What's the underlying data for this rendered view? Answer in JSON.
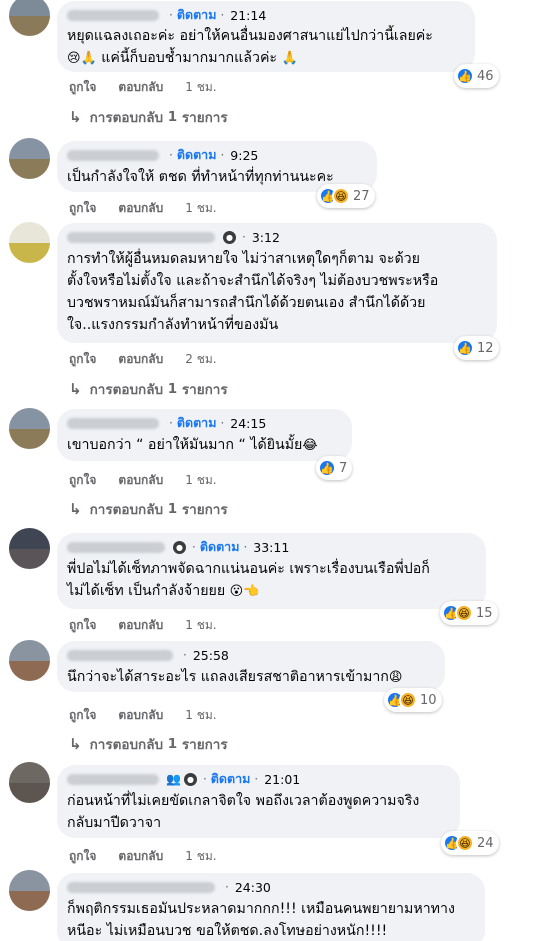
{
  "labels": {
    "follow": "ติดตาม",
    "like": "ถูกใจ",
    "reply": "ตอบกลับ",
    "replies_prefix": "การตอบกลับ",
    "replies_suffix": "รายการ"
  },
  "comments": [
    {
      "time": "21:14",
      "following": true,
      "lines": [
        "หยุดแฉลงเถอะค่ะ อย่าให้คนอื่นมองศาสนาแย่ไปกว่านี้เลยค่ะ",
        "แค่นี้ก็บอบช้ำมากมากแล้วค่ะ"
      ],
      "age": "1 ชม.",
      "reactions": [
        "like"
      ],
      "reaction_count": "46",
      "reply_count": "1"
    },
    {
      "time": "9:25",
      "following": true,
      "lines": [
        "เป็นกำลังใจให้ ตชด ที่ทำหน้าที่ทุกท่านนะคะ"
      ],
      "age": "1 ชม.",
      "reactions": [
        "like",
        "haha"
      ],
      "reaction_count": "27",
      "reply_count": null
    },
    {
      "time": "3:12",
      "following": false,
      "lines": [
        "การทำให้ผู้อื่นหมดลมหายใจ ไม่ว่าสาเหตุใดๆก็ตาม จะด้วย",
        "ตั้งใจหรือไม่ตั้งใจ และถ้าจะสำนึกได้จริงๆ ไม่ต้องบวชพระหรือ",
        "บวชพราหมณ์มันก็สามารถสำนึกได้ด้วยตนเอง สำนึกได้ด้วย",
        "ใจ..แรงกรรมกำลังทำหน้าที่ของมัน"
      ],
      "age": "2 ชม.",
      "reactions": [
        "like"
      ],
      "reaction_count": "12",
      "reply_count": "1"
    },
    {
      "time": "24:15",
      "following": true,
      "lines": [
        "เขาบอกว่า “ อย่าให้มันมาก “ ได้ยินมั้ย"
      ],
      "age": "1 ชม.",
      "reactions": [
        "like"
      ],
      "reaction_count": "7",
      "reply_count": "1"
    },
    {
      "time": "33:11",
      "following": true,
      "lines": [
        "พี่ปอไม่ได้เซ็ทภาพจัดฉากแน่นอนค่ะ เพราะเรื่องบนเรือพี่ปอก็",
        "ไม่ได้เซ็ท เป็นกำลังจ้ายยย"
      ],
      "age": "1 ชม.",
      "reactions": [
        "like",
        "haha"
      ],
      "reaction_count": "15",
      "reply_count": null
    },
    {
      "time": "25:58",
      "following": false,
      "lines": [
        "นึกว่าจะได้สาระอะไร แถลงเสียรสชาติอาหารเข้ามาก"
      ],
      "age": "1 ชม.",
      "reactions": [
        "like",
        "haha"
      ],
      "reaction_count": "10",
      "reply_count": "1"
    },
    {
      "time": "21:01",
      "following": true,
      "lines": [
        "ก่อนหน้าที่ไม่เคยขัดเกลาจิตใจ พอถึงเวลาต้องพูดความจริง",
        "กลับมาปีดวาจา"
      ],
      "age": "1 ชม.",
      "reactions": [
        "like",
        "haha"
      ],
      "reaction_count": "24",
      "reply_count": null
    },
    {
      "time": "24:30",
      "following": false,
      "lines": [
        "ก็พฤติกรรมเธอมันประหลาดมากกก!!! เหมือนคนพยายามหาทาง",
        "หนีอะ ไม่เหมือนบวช ขอให้ตชด.ลงโทษอย่างหนัก!!!!"
      ],
      "age": null,
      "reactions": [],
      "reaction_count": null,
      "reply_count": null
    }
  ]
}
